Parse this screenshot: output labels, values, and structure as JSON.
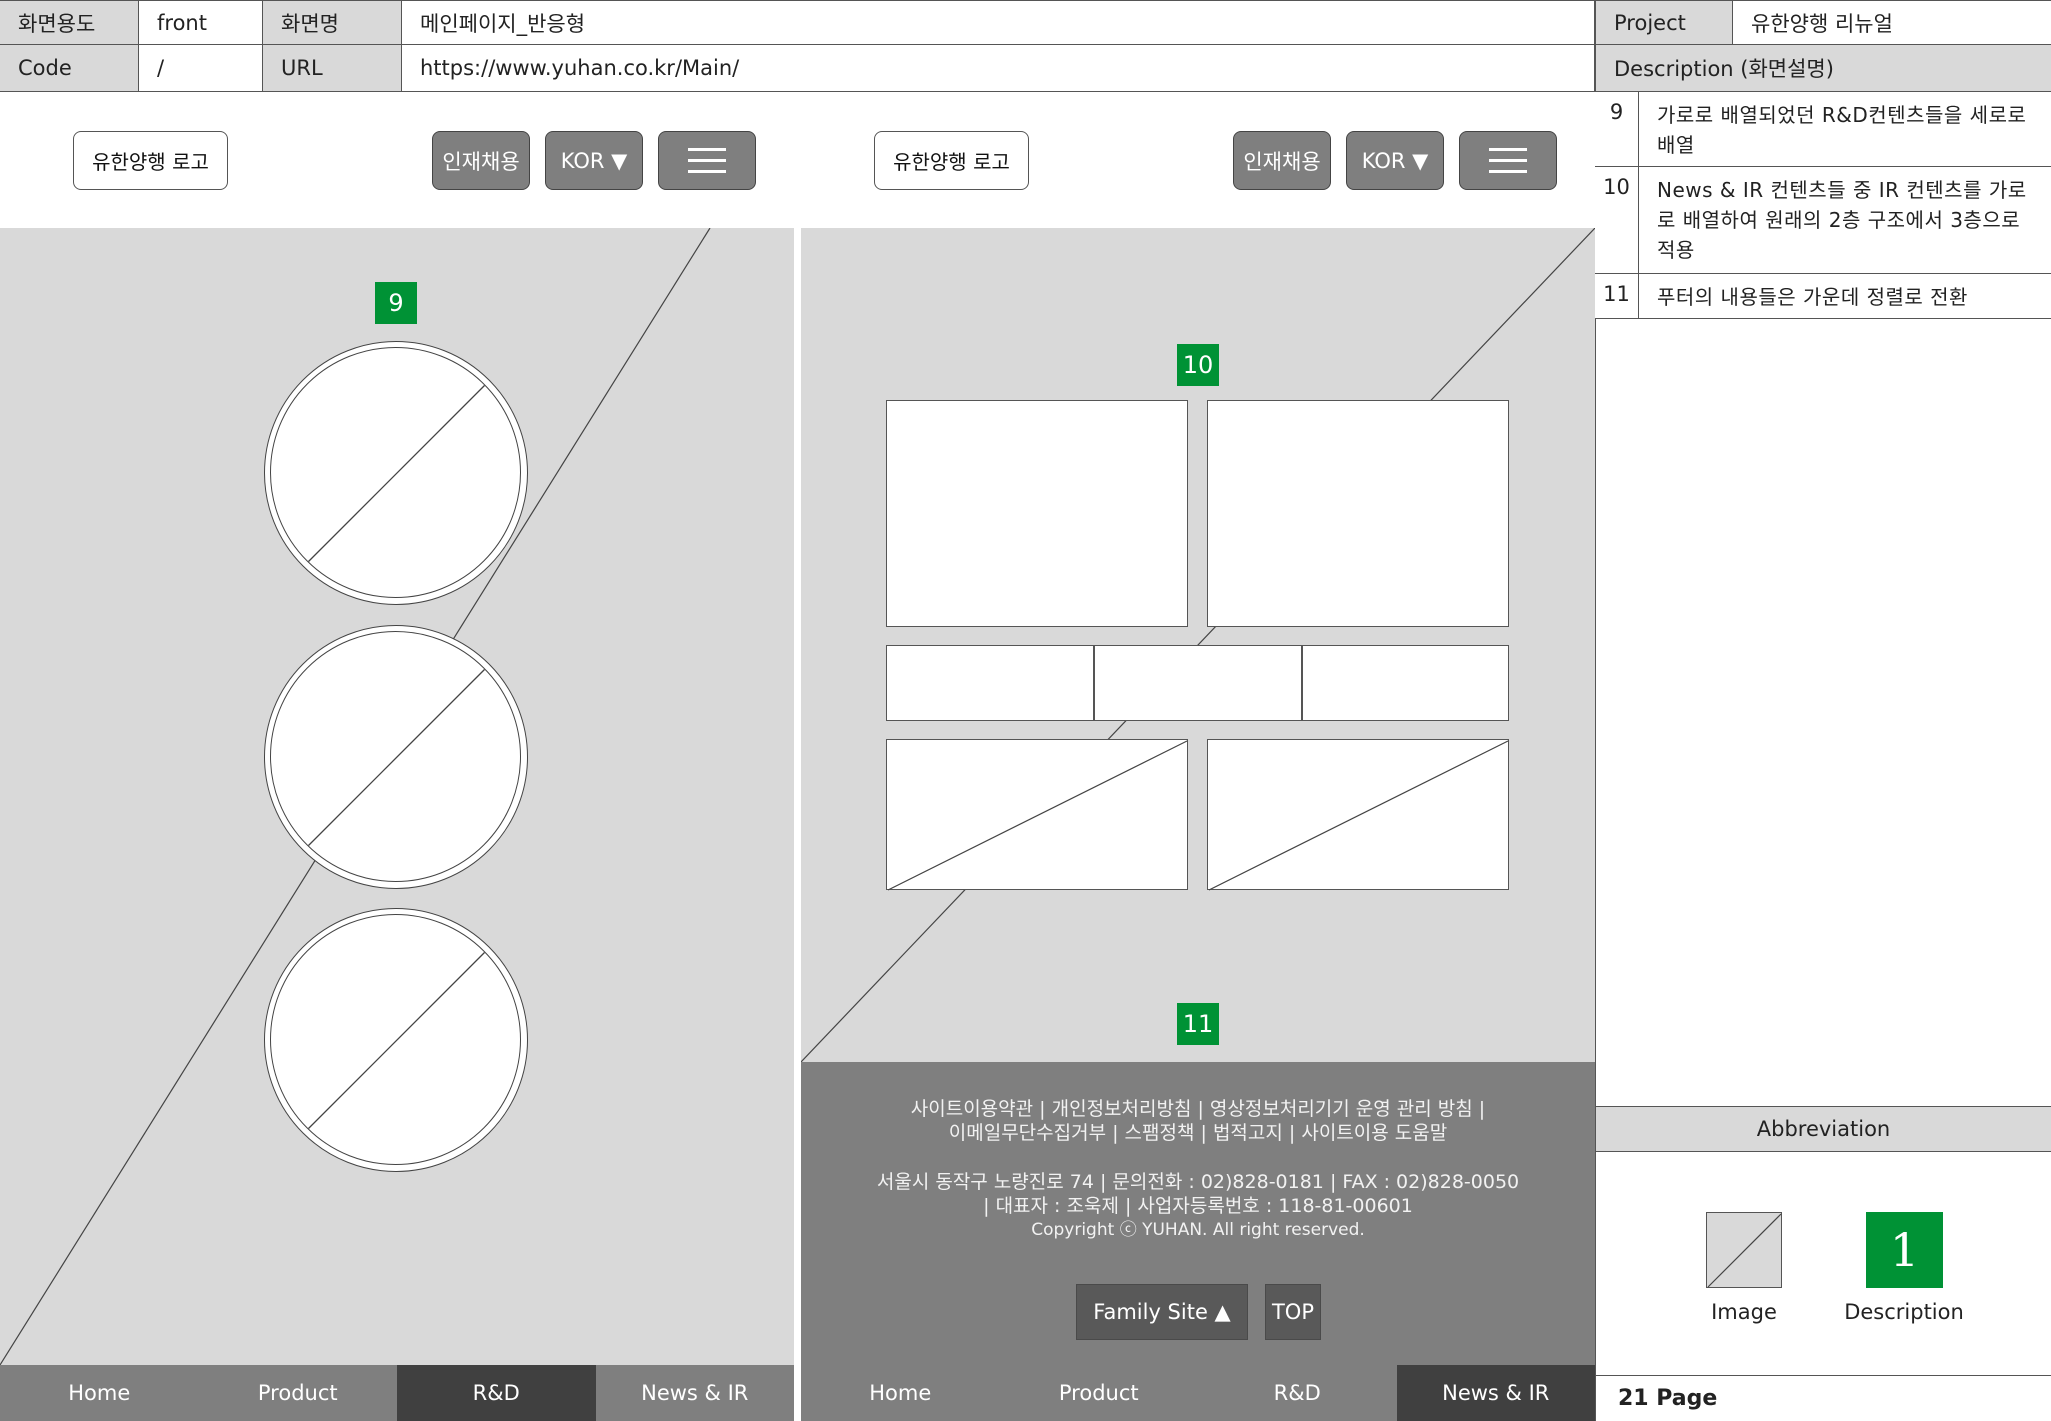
{
  "header": {
    "screen_use_label": "화면용도",
    "screen_use_value": "front",
    "screen_name_label": "화면명",
    "screen_name_value": "메인페이지_반응형",
    "code_label": "Code",
    "code_value": "/",
    "url_label": "URL",
    "url_value": "https://www.yuhan.co.kr/Main/",
    "project_label": "Project",
    "project_value": "유한양행 리뉴얼",
    "description_title": "Description (화면설명)"
  },
  "mockup": {
    "logo_label": "유한양행 로고",
    "recruit_label": "인재채용",
    "lang_label": "KOR ▼",
    "menu_icon": "hamburger-icon",
    "badges": [
      "9",
      "10",
      "11"
    ],
    "nav": [
      "Home",
      "Product",
      "R&D",
      "News & IR"
    ],
    "left_active_nav": "R&D",
    "right_active_nav": "News & IR",
    "footer": {
      "line1": "사이트이용약관 | 개인정보처리방침 | 영상정보처리기기 운영 관리 방침 |",
      "line2": "이메일무단수집거부 | 스팸정책 | 법적고지 | 사이트이용 도움말",
      "line3": "서울시 동작구 노량진로 74 | 문의전화 : 02)828-0181 | FAX : 02)828-0050",
      "line4": "| 대표자 : 조욱제 | 사업자등록번호 : 118-81-00601",
      "line5": "Copyright ⓒ YUHAN. All right reserved.",
      "family_site": "Family Site ▲",
      "top": "TOP"
    }
  },
  "descriptions": [
    {
      "num": "9",
      "text": "가로로 배열되었던 R&D컨텐츠들을 세로로 배열"
    },
    {
      "num": "10",
      "text": "News & IR 컨텐츠들 중 IR 컨텐츠를 가로로 배열하여 원래의 2층 구조에서 3층으로 적용"
    },
    {
      "num": "11",
      "text": "푸터의 내용들은 가운데 정렬로 전환"
    }
  ],
  "abbreviation": {
    "title": "Abbreviation",
    "image_label": "Image",
    "desc_badge": "1",
    "desc_label": "Description"
  },
  "page_label": "21 Page",
  "colors": {
    "badge_green": "#009235",
    "nav_bg": "#7f7f7f",
    "nav_active": "#404040",
    "canvas_gray": "#d9d9d9",
    "footer_bg": "#7f7f7f"
  }
}
